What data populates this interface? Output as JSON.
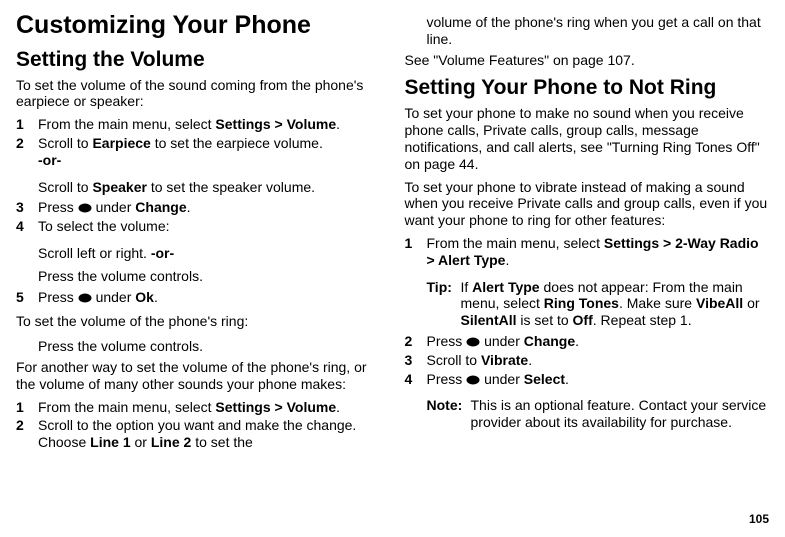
{
  "pagenum": "105",
  "left": {
    "h1": "Customizing Your Phone",
    "h2": "Setting the Volume",
    "intro": "To set the volume of the sound coming from the phone's earpiece or speaker:",
    "steps1": [
      {
        "n": "1",
        "pre": "From the main menu, select ",
        "b": "Settings > Volume",
        "post": "."
      },
      {
        "n": "2",
        "pre": "Scroll to ",
        "b": "Earpiece",
        "post": " to set the earpiece volume."
      }
    ],
    "or1": "-or-",
    "sub2": {
      "pre": "Scroll to ",
      "b": "Speaker",
      "post": " to set the speaker volume."
    },
    "step3": {
      "n": "3",
      "pre": "Press ",
      "icon": true,
      "mid": " under ",
      "b": "Change",
      "post": "."
    },
    "step4": {
      "n": "4",
      "text": "To select the volume:"
    },
    "sub4a": "Scroll left or right. ",
    "sub4a_or": "-or-",
    "sub4b": "Press the volume controls.",
    "step5": {
      "n": "5",
      "pre": "Press ",
      "icon": true,
      "mid": " under ",
      "b": "Ok",
      "post": "."
    },
    "ringIntro": "To set the volume of the phone's ring:",
    "ringSub": "Press the volume controls.",
    "anotherWay": "For another way to set the volume of the phone's ring, or the volume of many other sounds your phone makes:",
    "steps2": [
      {
        "n": "1",
        "pre": "From the main menu, select ",
        "b": "Settings > Volume",
        "post": "."
      },
      {
        "n": "2",
        "pre": "Scroll to the option you want and make the change. Choose ",
        "b": "Line 1",
        "mid": " or ",
        "b2": "Line 2",
        "post": " to set the "
      }
    ]
  },
  "right": {
    "cont": "volume of the phone's ring when you get a call on that line.",
    "see": "See \"Volume Features\" on page 107.",
    "h2": "Setting Your Phone to Not Ring",
    "para1": "To set your phone to make no sound when you receive phone calls, Private calls, group calls, message notifications, and call alerts, see \"Turning Ring Tones Off\" on page 44.",
    "para2": "To set your phone to vibrate instead of making a sound when you receive Private calls and group calls, even if you want your phone to ring for other features:",
    "step1": {
      "n": "1",
      "pre": "From the main menu, select ",
      "b": "Settings > 2-Way Radio > Alert Type",
      "post": "."
    },
    "tipLabel": "Tip:",
    "tip": {
      "pre": " If ",
      "b1": "Alert Type",
      "mid1": " does not appear: From the main menu, select ",
      "b2": "Ring Tones",
      "mid2": ". Make sure ",
      "b3": "VibeAll",
      "mid3": " or ",
      "b4": "SilentAll",
      "mid4": " is set to ",
      "b5": "Off",
      "post": ". Repeat step 1."
    },
    "step2": {
      "n": "2",
      "pre": "Press ",
      "icon": true,
      "mid": " under ",
      "b": "Change",
      "post": "."
    },
    "step3": {
      "n": "3",
      "pre": "Scroll to ",
      "b": "Vibrate",
      "post": "."
    },
    "step4": {
      "n": "4",
      "pre": "Press ",
      "icon": true,
      "mid": " under ",
      "b": "Select",
      "post": "."
    },
    "noteLabel": "Note:",
    "note": " This is an optional feature. Contact your service provider about its availability for purchase."
  }
}
